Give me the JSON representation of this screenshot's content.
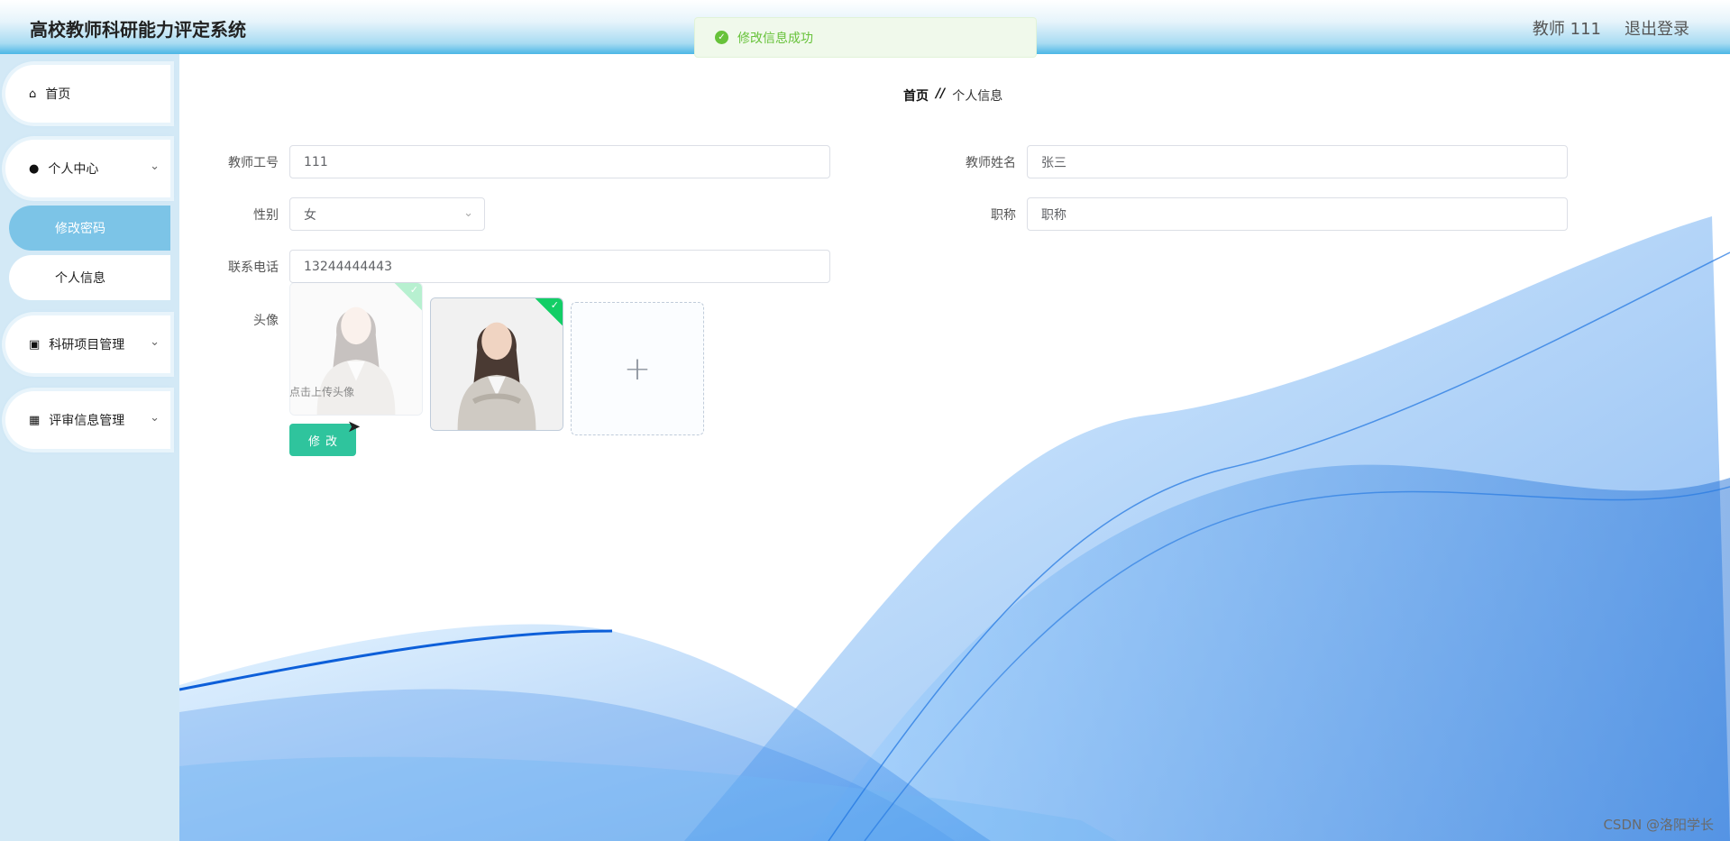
{
  "header": {
    "title": "高校教师科研能力评定系统",
    "user": "教师 111",
    "logout": "退出登录"
  },
  "toast": {
    "message": "修改信息成功"
  },
  "sidebar": {
    "items": [
      {
        "label": "首页",
        "icon": "home-icon"
      },
      {
        "label": "个人中心",
        "icon": "user-icon",
        "children": [
          {
            "label": "修改密码"
          },
          {
            "label": "个人信息"
          }
        ]
      },
      {
        "label": "科研项目管理",
        "icon": "clipboard-icon"
      },
      {
        "label": "评审信息管理",
        "icon": "grid-icon"
      }
    ]
  },
  "breadcrumb": {
    "home": "首页",
    "sep": "//",
    "current": "个人信息"
  },
  "form": {
    "teacher_id": {
      "label": "教师工号",
      "value": "111"
    },
    "teacher_name": {
      "label": "教师姓名",
      "value": "张三"
    },
    "gender": {
      "label": "性别",
      "value": "女"
    },
    "title": {
      "label": "职称",
      "value": "职称"
    },
    "phone": {
      "label": "联系电话",
      "value": "13244444443"
    },
    "avatar": {
      "label": "头像",
      "hint": "点击上传头像",
      "upload_glyph": "+"
    },
    "submit_label": "修改"
  },
  "watermark": "CSDN @洛阳学长",
  "colors": {
    "accent": "#2fc49d",
    "sidebar_bg": "#d3e9f6",
    "active_menu": "#7cc4e7",
    "toast_green": "#67c23a"
  }
}
